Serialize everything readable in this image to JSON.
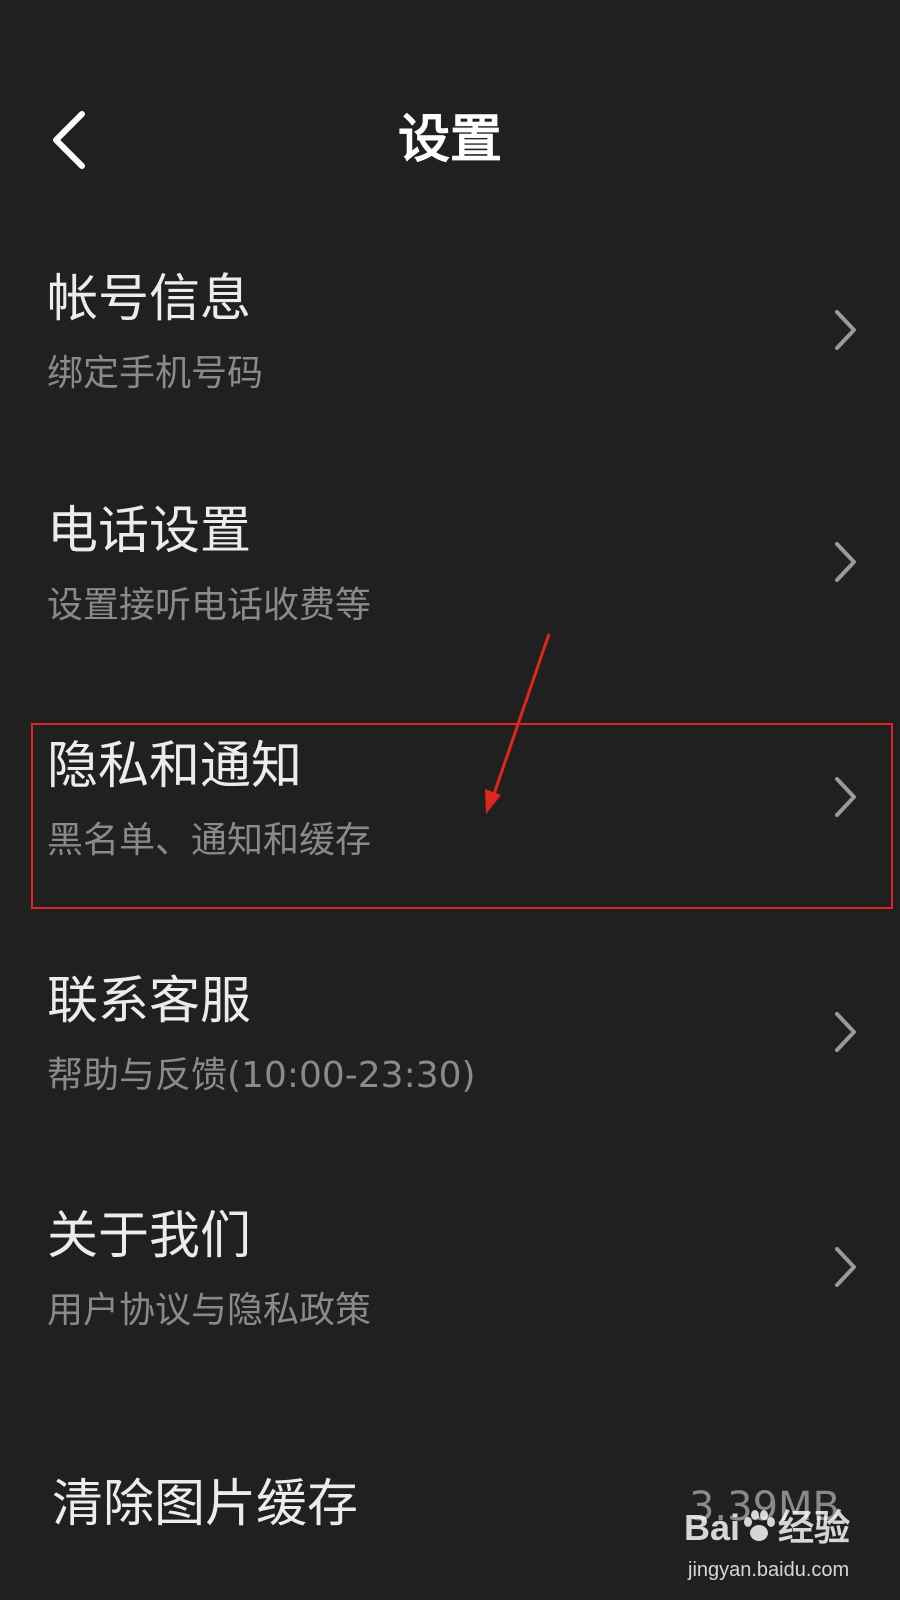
{
  "header": {
    "title": "设置",
    "back_icon": "chevron-left-icon"
  },
  "items": [
    {
      "title": "帐号信息",
      "subtitle": "绑定手机号码",
      "icon": "chevron-right-icon"
    },
    {
      "title": "电话设置",
      "subtitle": "设置接听电话收费等",
      "icon": "chevron-right-icon"
    },
    {
      "title": "隐私和通知",
      "subtitle": "黑名单、通知和缓存",
      "icon": "chevron-right-icon"
    },
    {
      "title": "联系客服",
      "subtitle": "帮助与反馈(10:00-23:30)",
      "icon": "chevron-right-icon"
    },
    {
      "title": "关于我们",
      "subtitle": "用户协议与隐私政策",
      "icon": "chevron-right-icon"
    }
  ],
  "cache": {
    "title": "清除图片缓存",
    "size": "3.39MB"
  },
  "annotation": {
    "color": "#e0251f"
  },
  "watermark": {
    "logo_left": "Bai",
    "logo_right": "经验",
    "url": "jingyan.baidu.com"
  },
  "colors": {
    "background": "#202020",
    "title_text": "#ececec",
    "subtitle_text": "#8a8a8a"
  }
}
